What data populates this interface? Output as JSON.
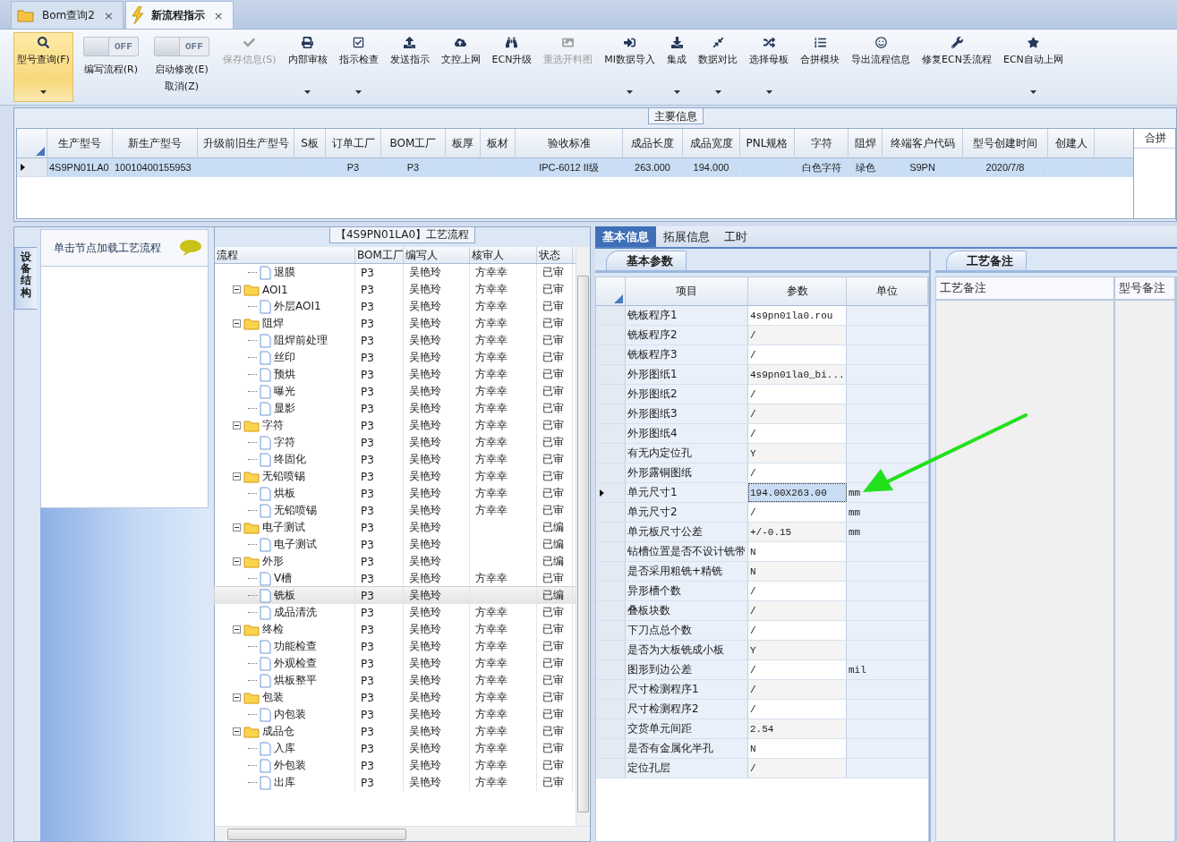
{
  "tabs": [
    {
      "label": "Bom查询2",
      "selected": false,
      "close": "×"
    },
    {
      "label": "新流程指示",
      "selected": true,
      "close": "×"
    }
  ],
  "toolbar": [
    {
      "kind": "button",
      "label": "型号查询(F)",
      "selected": true,
      "disabled": false,
      "dropdown": true
    },
    {
      "kind": "toggle",
      "toggle_text": "OFF",
      "on": false,
      "lines": [
        "编写流程(R)"
      ]
    },
    {
      "kind": "toggle",
      "toggle_text": "OFF",
      "on": false,
      "lines": [
        "启动修改(E)",
        "取消(Z)"
      ]
    },
    {
      "kind": "button",
      "label": "保存信息(S)",
      "selected": false,
      "disabled": true,
      "dropdown": false
    },
    {
      "kind": "button",
      "label": "内部审核",
      "selected": false,
      "disabled": false,
      "dropdown": true
    },
    {
      "kind": "button",
      "label": "指示检查",
      "selected": false,
      "disabled": false,
      "dropdown": true
    },
    {
      "kind": "button",
      "label": "发送指示",
      "selected": false,
      "disabled": false,
      "dropdown": false
    },
    {
      "kind": "button",
      "label": "文控上网",
      "selected": false,
      "disabled": false,
      "dropdown": false
    },
    {
      "kind": "button",
      "label": "ECN升级",
      "selected": false,
      "disabled": false,
      "dropdown": false
    },
    {
      "kind": "button",
      "label": "重选开料图",
      "selected": false,
      "disabled": true,
      "dropdown": false
    },
    {
      "kind": "button",
      "label": "MI数据导入",
      "selected": false,
      "disabled": false,
      "dropdown": true
    },
    {
      "kind": "button",
      "label": "集成",
      "selected": false,
      "disabled": false,
      "dropdown": true
    },
    {
      "kind": "button",
      "label": "数据对比",
      "selected": false,
      "disabled": false,
      "dropdown": true
    },
    {
      "kind": "button",
      "label": "选择母板",
      "selected": false,
      "disabled": false,
      "dropdown": true
    },
    {
      "kind": "button",
      "label": "合拼模块",
      "selected": false,
      "disabled": false,
      "dropdown": false
    },
    {
      "kind": "button",
      "label": "导出流程信息",
      "selected": false,
      "disabled": false,
      "dropdown": false
    },
    {
      "kind": "button",
      "label": "修复ECN丢流程",
      "selected": false,
      "disabled": false,
      "dropdown": false
    },
    {
      "kind": "button",
      "label": "ECN自动上网",
      "selected": false,
      "disabled": false,
      "dropdown": true
    }
  ],
  "main_info": {
    "title": "主要信息",
    "columns": [
      "生产型号",
      "新生产型号",
      "升级前旧生产型号",
      "S板",
      "订单工厂",
      "BOM工厂",
      "板厚",
      "板材",
      "验收标准",
      "成品长度",
      "成品宽度",
      "PNL规格",
      "字符",
      "阻焊",
      "终端客户代码",
      "型号创建时间",
      "创建人"
    ],
    "rows": [
      {
        "selected": true,
        "cells": [
          "4S9PN01LA0",
          "10010400155953",
          null,
          null,
          "P3",
          "P3",
          null,
          null,
          "IPC-6012 II级",
          "263.000",
          "194.000",
          null,
          "白色字符",
          "绿色",
          "S9PN",
          "2020/7/8",
          null
        ]
      }
    ],
    "side_column": "合拼"
  },
  "left_panel": {
    "side_tab": "设备结构",
    "hint": "单击节点加载工艺流程"
  },
  "process_flow": {
    "title": "【4S9PN01LA0】工艺流程",
    "columns": [
      "流程",
      "BOM工厂",
      "编写人",
      "核审人",
      "状态"
    ],
    "nodes": [
      {
        "children": [
          {
            "label": "退膜",
            "kind": "file",
            "selected": false,
            "bom": "P3",
            "writer": "吴艳玲",
            "reviewer": "方幸幸",
            "status": "已审"
          }
        ]
      },
      {
        "label": "AOI1",
        "kind": "folder",
        "expanded": true,
        "selected": false,
        "bom": "P3",
        "writer": "吴艳玲",
        "reviewer": "方幸幸",
        "status": "已审",
        "children": [
          {
            "label": "外层AOI1",
            "kind": "file",
            "selected": false,
            "bom": "P3",
            "writer": "吴艳玲",
            "reviewer": "方幸幸",
            "status": "已审"
          }
        ]
      },
      {
        "label": "阻焊",
        "kind": "folder",
        "expanded": true,
        "selected": false,
        "bom": "P3",
        "writer": "吴艳玲",
        "reviewer": "方幸幸",
        "status": "已审",
        "children": [
          {
            "label": "阻焊前处理",
            "kind": "file",
            "selected": false,
            "bom": "P3",
            "writer": "吴艳玲",
            "reviewer": "方幸幸",
            "status": "已审"
          },
          {
            "label": "丝印",
            "kind": "file",
            "selected": false,
            "bom": "P3",
            "writer": "吴艳玲",
            "reviewer": "方幸幸",
            "status": "已审"
          },
          {
            "label": "预烘",
            "kind": "file",
            "selected": false,
            "bom": "P3",
            "writer": "吴艳玲",
            "reviewer": "方幸幸",
            "status": "已审"
          },
          {
            "label": "曝光",
            "kind": "file",
            "selected": false,
            "bom": "P3",
            "writer": "吴艳玲",
            "reviewer": "方幸幸",
            "status": "已审"
          },
          {
            "label": "显影",
            "kind": "file",
            "selected": false,
            "bom": "P3",
            "writer": "吴艳玲",
            "reviewer": "方幸幸",
            "status": "已审"
          }
        ]
      },
      {
        "label": "字符",
        "kind": "folder",
        "expanded": true,
        "selected": false,
        "bom": "P3",
        "writer": "吴艳玲",
        "reviewer": "方幸幸",
        "status": "已审",
        "children": [
          {
            "label": "字符",
            "kind": "file",
            "selected": false,
            "bom": "P3",
            "writer": "吴艳玲",
            "reviewer": "方幸幸",
            "status": "已审"
          },
          {
            "label": "终固化",
            "kind": "file",
            "selected": false,
            "bom": "P3",
            "writer": "吴艳玲",
            "reviewer": "方幸幸",
            "status": "已审"
          }
        ]
      },
      {
        "label": "无铅喷锡",
        "kind": "folder",
        "expanded": true,
        "selected": false,
        "bom": "P3",
        "writer": "吴艳玲",
        "reviewer": "方幸幸",
        "status": "已审",
        "children": [
          {
            "label": "烘板",
            "kind": "file",
            "selected": false,
            "bom": "P3",
            "writer": "吴艳玲",
            "reviewer": "方幸幸",
            "status": "已审"
          },
          {
            "label": "无铅喷锡",
            "kind": "file",
            "selected": false,
            "bom": "P3",
            "writer": "吴艳玲",
            "reviewer": "方幸幸",
            "status": "已审"
          }
        ]
      },
      {
        "label": "电子测试",
        "kind": "folder",
        "expanded": true,
        "selected": false,
        "bom": "P3",
        "writer": "吴艳玲",
        "status": "已编",
        "children": [
          {
            "label": "电子测试",
            "kind": "file",
            "selected": false,
            "bom": "P3",
            "writer": "吴艳玲",
            "status": "已编"
          }
        ]
      },
      {
        "label": "外形",
        "kind": "folder",
        "expanded": true,
        "selected": false,
        "bom": "P3",
        "writer": "吴艳玲",
        "status": "已编",
        "children": [
          {
            "label": "V槽",
            "kind": "file",
            "selected": false,
            "bom": "P3",
            "writer": "吴艳玲",
            "reviewer": "方幸幸",
            "status": "已审"
          },
          {
            "label": "铣板",
            "kind": "file",
            "selected": true,
            "bom": "P3",
            "writer": "吴艳玲",
            "status": "已编"
          },
          {
            "label": "成品清洗",
            "kind": "file",
            "selected": false,
            "bom": "P3",
            "writer": "吴艳玲",
            "reviewer": "方幸幸",
            "status": "已审"
          }
        ]
      },
      {
        "label": "终检",
        "kind": "folder",
        "expanded": true,
        "selected": false,
        "bom": "P3",
        "writer": "吴艳玲",
        "reviewer": "方幸幸",
        "status": "已审",
        "children": [
          {
            "label": "功能检查",
            "kind": "file",
            "selected": false,
            "bom": "P3",
            "writer": "吴艳玲",
            "reviewer": "方幸幸",
            "status": "已审"
          },
          {
            "label": "外观检查",
            "kind": "file",
            "selected": false,
            "bom": "P3",
            "writer": "吴艳玲",
            "reviewer": "方幸幸",
            "status": "已审"
          },
          {
            "label": "烘板整平",
            "kind": "file",
            "selected": false,
            "bom": "P3",
            "writer": "吴艳玲",
            "reviewer": "方幸幸",
            "status": "已审"
          }
        ]
      },
      {
        "label": "包装",
        "kind": "folder",
        "expanded": true,
        "selected": false,
        "bom": "P3",
        "writer": "吴艳玲",
        "reviewer": "方幸幸",
        "status": "已审",
        "children": [
          {
            "label": "内包装",
            "kind": "file",
            "selected": false,
            "bom": "P3",
            "writer": "吴艳玲",
            "reviewer": "方幸幸",
            "status": "已审"
          }
        ]
      },
      {
        "label": "成品仓",
        "kind": "folder",
        "expanded": true,
        "selected": false,
        "bom": "P3",
        "writer": "吴艳玲",
        "reviewer": "方幸幸",
        "status": "已审",
        "children": [
          {
            "label": "入库",
            "kind": "file",
            "selected": false,
            "bom": "P3",
            "writer": "吴艳玲",
            "reviewer": "方幸幸",
            "status": "已审"
          },
          {
            "label": "外包装",
            "kind": "file",
            "selected": false,
            "bom": "P3",
            "writer": "吴艳玲",
            "reviewer": "方幸幸",
            "status": "已审"
          },
          {
            "label": "出库",
            "kind": "file",
            "selected": false,
            "bom": "P3",
            "writer": "吴艳玲",
            "reviewer": "方幸幸",
            "status": "已审"
          }
        ]
      }
    ]
  },
  "detail": {
    "tabs": [
      {
        "label": "基本信息",
        "selected": true
      },
      {
        "label": "拓展信息",
        "selected": false
      },
      {
        "label": "工时",
        "selected": false
      }
    ],
    "params": {
      "title": "基本参数",
      "columns": [
        "项目",
        "参数",
        "单位"
      ],
      "rows": [
        {
          "item": "铣板程序1",
          "value": "4s9pn01la0.rou",
          "selected": false
        },
        {
          "item": "铣板程序2",
          "value": "/",
          "selected": false
        },
        {
          "item": "铣板程序3",
          "value": "/",
          "selected": false
        },
        {
          "item": "外形图纸1",
          "value": "4s9pn01la0_bi...",
          "selected": false
        },
        {
          "item": "外形图纸2",
          "value": "/",
          "selected": false
        },
        {
          "item": "外形图纸3",
          "value": "/",
          "selected": false
        },
        {
          "item": "外形图纸4",
          "value": "/",
          "selected": false
        },
        {
          "item": "有无内定位孔",
          "value": "Y",
          "selected": false
        },
        {
          "item": "外形露铜图纸",
          "value": "/",
          "selected": false
        },
        {
          "item": "单元尺寸1",
          "value": "194.00X263.00",
          "unit": "mm",
          "selected": true
        },
        {
          "item": "单元尺寸2",
          "value": "/",
          "unit": "mm",
          "selected": false
        },
        {
          "item": "单元板尺寸公差",
          "value": "+/-0.15",
          "unit": "mm",
          "selected": false
        },
        {
          "item": "钻槽位置是否不设计铣带",
          "value": "N",
          "selected": false
        },
        {
          "item": "是否采用粗铣+精铣",
          "value": "N",
          "selected": false
        },
        {
          "item": "异形槽个数",
          "value": "/",
          "selected": false
        },
        {
          "item": "叠板块数",
          "value": "/",
          "selected": false
        },
        {
          "item": "下刀点总个数",
          "value": "/",
          "selected": false
        },
        {
          "item": "是否为大板铣成小板",
          "value": "Y",
          "selected": false
        },
        {
          "item": "图形到边公差",
          "value": "/",
          "unit": "mil",
          "selected": false
        },
        {
          "item": "尺寸检测程序1",
          "value": "/",
          "selected": false
        },
        {
          "item": "尺寸检测程序2",
          "value": "/",
          "selected": false
        },
        {
          "item": "交货单元间距",
          "value": "2.54",
          "selected": false
        },
        {
          "item": "是否有金属化半孔",
          "value": "N",
          "selected": false
        },
        {
          "item": "定位孔层",
          "value": "/",
          "selected": false
        }
      ]
    },
    "remarks": {
      "title": "工艺备注",
      "columns": [
        "工艺备注",
        "型号备注"
      ]
    }
  }
}
